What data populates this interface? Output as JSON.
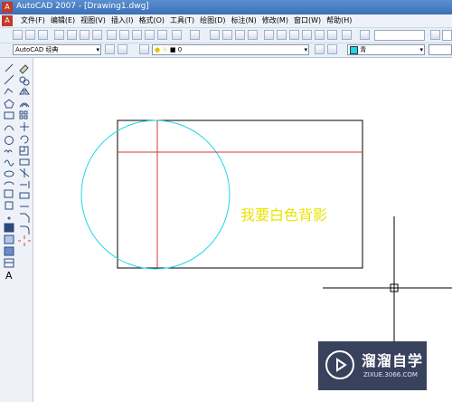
{
  "window": {
    "title": "AutoCAD 2007 - [Drawing1.dwg]",
    "app_icon_letter": "A"
  },
  "menubar": {
    "items": [
      "文件(F)",
      "编辑(E)",
      "视图(V)",
      "插入(I)",
      "格式(O)",
      "工具(T)",
      "绘图(D)",
      "标注(N)",
      "修改(M)",
      "窗口(W)",
      "帮助(H)"
    ]
  },
  "toolbar2": {
    "text_style": "AutoCAD 经典",
    "layer": "0",
    "color": "青"
  },
  "drawing": {
    "text": "我要白色背影",
    "text_color": "#e9e400",
    "circle_color": "#1fd7e6",
    "centerline_color": "#d23a3a",
    "rect_color": "#000000",
    "crosshair_color": "#000000"
  },
  "watermark": {
    "title": "溜溜自学",
    "url": "ZIXUE.3066.COM"
  }
}
